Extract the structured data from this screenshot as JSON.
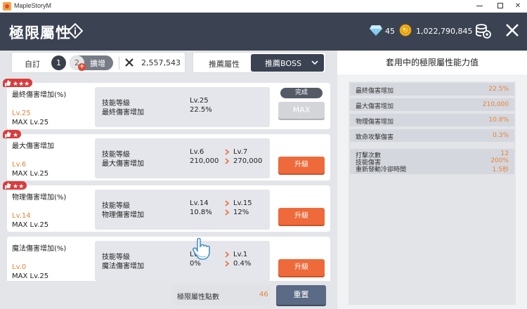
{
  "window": {
    "title": "MapleStoryM"
  },
  "header": {
    "title": "極限屬性",
    "gems": "45",
    "mesos": "1,022,790,845"
  },
  "tabbar": {
    "custom_label": "自訂",
    "preset_1": "1",
    "preset_2": "2",
    "expand_plus": "+",
    "expand_label": "擴增",
    "points": "2,557,543"
  },
  "recommend": {
    "label": "推薦屬性",
    "selected": "推薦BOSS"
  },
  "skills": [
    {
      "name": "最終傷害增加(%)",
      "current_level": "Lv.25",
      "max_level": "MAX Lv.25",
      "row1_key": "技能等級",
      "row2_key": "最終傷害增加",
      "row1_val": "Lv.25",
      "row2_val": "22.5%",
      "badge": "完成",
      "button": "MAX",
      "stars": 3
    },
    {
      "name": "最大傷害增加",
      "current_level": "Lv.6",
      "max_level": "MAX Lv.25",
      "row1_key": "技能等級",
      "row2_key": "最大傷害增加",
      "row1_val": "Lv.6",
      "row2_val": "210,000",
      "row1_next": "Lv.7",
      "row2_next": "270,000",
      "button": "升級",
      "stars": 1
    },
    {
      "name": "物理傷害增加(%)",
      "current_level": "Lv.14",
      "max_level": "MAX Lv.25",
      "row1_key": "技能等級",
      "row2_key": "物理傷害增加",
      "row1_val": "Lv.14",
      "row2_val": "10.8%",
      "row1_next": "Lv.15",
      "row2_next": "12%",
      "button": "升級",
      "stars": 2
    },
    {
      "name": "魔法傷害增加(%)",
      "current_level": "Lv.0",
      "max_level": "MAX Lv.25",
      "row1_key": "技能等級",
      "row2_key": "魔法傷害增加",
      "row1_val": "Lv.",
      "row2_val": "0%",
      "row1_next": "Lv.1",
      "row2_next": "0.4%",
      "button": "升級"
    }
  ],
  "footer": {
    "points_label": "極限屬性點數",
    "points_value": "46",
    "reset_label": "重置"
  },
  "right_panel": {
    "title": "套用中的極限屬性能力值",
    "rows": [
      {
        "key": "最終傷害增加",
        "value": "22.5%"
      },
      {
        "key": "最大傷害增加",
        "value": "210,000"
      },
      {
        "key": "物理傷害增加",
        "value": "10.8%"
      },
      {
        "key": "致命攻擊傷害",
        "value": "0.3%"
      }
    ],
    "multi": [
      {
        "key": "打擊次數",
        "value": "12"
      },
      {
        "key": "技能傷害",
        "value": "200%"
      },
      {
        "key": "重新發動冷卻時間",
        "value": "1.5秒"
      }
    ]
  },
  "colors": {
    "header_bg": "#3b4252",
    "accent_orange": "#ee6a3a",
    "value_orange": "#e8833a",
    "badge_red": "#d93c3c",
    "reset_blue": "#5b6a85"
  }
}
